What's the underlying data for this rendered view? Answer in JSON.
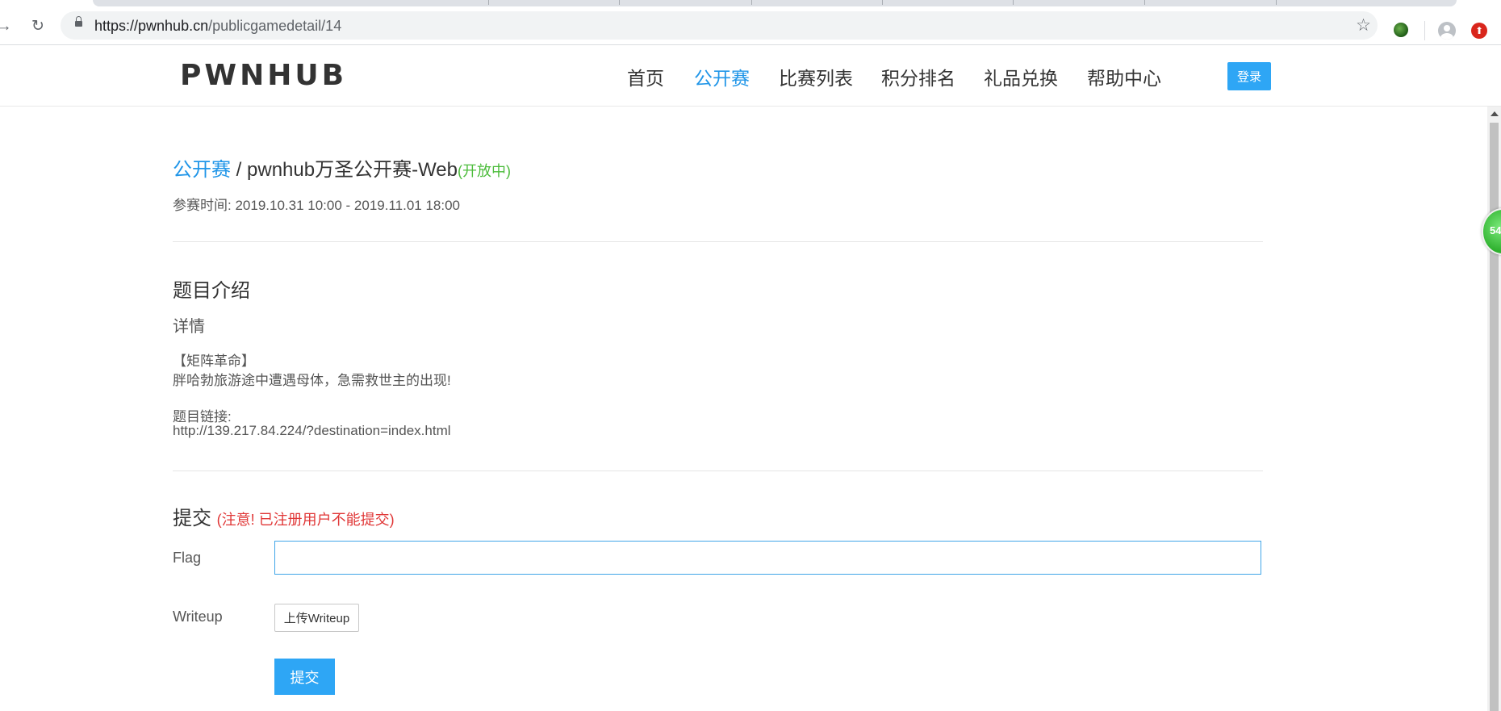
{
  "browser": {
    "url_host": "https://pwnhub.cn",
    "url_path": "/publicgamedetail/14"
  },
  "header": {
    "logo": "PWNHUB",
    "nav": [
      {
        "label": "首页"
      },
      {
        "label": "公开赛",
        "active": true
      },
      {
        "label": "比赛列表"
      },
      {
        "label": "积分排名"
      },
      {
        "label": "礼品兑换"
      },
      {
        "label": "帮助中心"
      }
    ],
    "login_label": "登录"
  },
  "floating_badge": "54",
  "game": {
    "breadcrumb": "公开赛",
    "separator": " / ",
    "name": "pwnhub万圣公开赛-Web",
    "status": "(开放中)",
    "time_label": "参赛时间:",
    "time_range": "2019.10.31 10:00 - 2019.11.01 18:00"
  },
  "intro": {
    "heading": "题目介绍",
    "detail_label": "详情",
    "lines": [
      "【矩阵革命】",
      "胖哈勃旅游途中遭遇母体，急需救世主的出现!",
      "题目链接:",
      "http://139.217.84.224/?destination=index.html"
    ]
  },
  "submit": {
    "heading": "提交",
    "notice": "(注意! 已注册用户不能提交)",
    "flag_label": "Flag",
    "flag_value": "",
    "writeup_label": "Writeup",
    "upload_label": "上传Writeup",
    "submit_label": "提交"
  },
  "colors": {
    "accent": "#2196e8",
    "status_open": "#4cbc3b",
    "notice": "#e03636",
    "button": "#2ea6f5"
  }
}
